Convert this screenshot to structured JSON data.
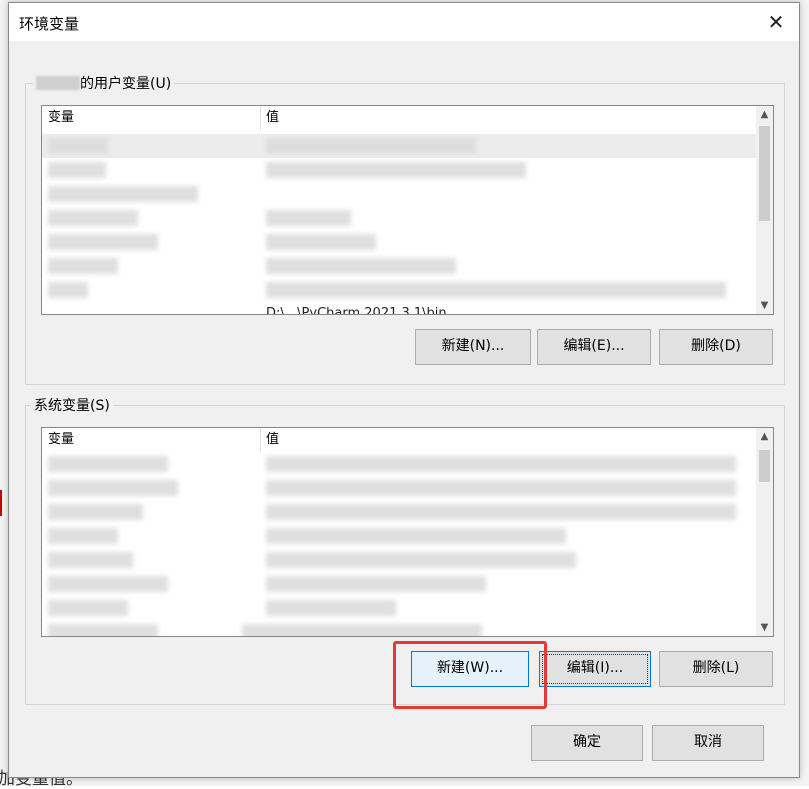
{
  "background": {
    "partial_text": "加变量值。"
  },
  "dialog": {
    "title": "环境变量",
    "close_glyph": "✕"
  },
  "user_vars": {
    "group_label": "的用户变量(U)",
    "col_variable": "变量",
    "col_value": "值",
    "visible_value_fragment": "D:\\...\\PyCharm 2021.3.1\\bin",
    "buttons": {
      "new": "新建(N)...",
      "edit": "编辑(E)...",
      "delete": "删除(D)"
    }
  },
  "system_vars": {
    "group_label": "系统变量(S)",
    "col_variable": "变量",
    "col_value": "值",
    "buttons": {
      "new": "新建(W)...",
      "edit": "编辑(I)...",
      "delete": "删除(L)"
    }
  },
  "footer": {
    "ok": "确定",
    "cancel": "取消"
  },
  "scroll": {
    "up_glyph": "▲",
    "down_glyph": "▼"
  },
  "colors": {
    "highlight": "#e53935",
    "focus": "#0078d7"
  }
}
